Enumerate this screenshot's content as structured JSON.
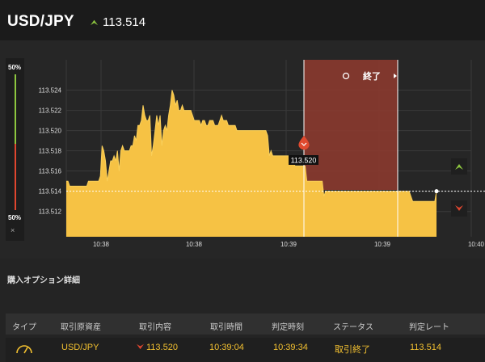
{
  "header": {
    "pair": "USD/JPY",
    "rate": "113.514",
    "colors": {
      "up": "#8dc63f",
      "down": "#e0462f"
    }
  },
  "chart_data": {
    "type": "area",
    "y_ticks": [
      "113.524",
      "113.522",
      "113.520",
      "113.518",
      "113.516",
      "113.514",
      "113.512"
    ],
    "x_ticks": [
      "10:38",
      "10:38",
      "10:39",
      "10:39",
      "10:40"
    ],
    "ylim": [
      113.5095,
      113.527
    ],
    "series": [
      {
        "values": [
          113.515,
          113.515,
          113.5145,
          113.5145,
          113.5145,
          113.5145,
          113.5145,
          113.5145,
          113.5145,
          113.5145,
          113.5145,
          113.5145,
          113.5145,
          113.515,
          113.515,
          113.515,
          113.515,
          113.515,
          113.515,
          113.515,
          113.5155,
          113.5185,
          113.518,
          113.517,
          113.515,
          113.516,
          113.517,
          113.517,
          113.5175,
          113.517,
          113.518,
          113.516,
          113.518,
          113.5185,
          113.518,
          113.518,
          113.518,
          113.518,
          113.5185,
          113.5185,
          113.5195,
          113.519,
          113.5205,
          113.5205,
          113.521,
          113.5225,
          113.5215,
          113.521,
          113.521,
          113.5215,
          113.5175,
          113.5185,
          113.52,
          113.5215,
          113.5205,
          113.5215,
          113.5185,
          113.52,
          113.5205,
          113.52,
          113.5215,
          113.5225,
          113.524,
          113.5235,
          113.5225,
          113.523,
          113.522,
          113.522,
          113.5225,
          113.522,
          113.522,
          113.522,
          113.522,
          113.522,
          113.5215,
          113.521,
          113.521,
          113.521,
          113.521,
          113.5205,
          113.521,
          113.521,
          113.5205,
          113.5205,
          113.521,
          113.521,
          113.521,
          113.5205,
          113.5205,
          113.5205,
          113.521,
          113.5215,
          113.521,
          113.521,
          113.521,
          113.5205,
          113.5205,
          113.5205,
          113.5205,
          113.5205,
          113.52,
          113.52,
          113.52,
          113.52,
          113.52,
          113.52,
          113.52,
          113.52,
          113.52,
          113.52,
          113.52,
          113.52,
          113.52,
          113.52,
          113.52,
          113.52,
          113.52,
          113.52,
          113.5195,
          113.5175,
          113.518,
          113.5175,
          113.5175,
          113.5175,
          113.5175,
          113.5175,
          113.5175,
          113.5175,
          113.5175,
          113.5175,
          113.5175,
          113.5175,
          113.5175,
          113.5175,
          113.5165,
          113.5165,
          113.5165,
          113.5165,
          113.5165,
          113.5165,
          113.5165,
          113.515,
          113.515,
          113.515,
          113.515,
          113.515,
          113.515,
          113.515,
          113.515,
          113.515,
          113.515,
          113.5135,
          113.514,
          113.514,
          113.514,
          113.514,
          113.514,
          113.514,
          113.514,
          113.514,
          113.514,
          113.514,
          113.514,
          113.514,
          113.514,
          113.514,
          113.514,
          113.514,
          113.514,
          113.514,
          113.514,
          113.514,
          113.514,
          113.514,
          113.514,
          113.514,
          113.514,
          113.514,
          113.514,
          113.514,
          113.514,
          113.514,
          113.514,
          113.514,
          113.514,
          113.514,
          113.514,
          113.514,
          113.514,
          113.514,
          113.514,
          113.514,
          113.514,
          113.514,
          113.514,
          113.514,
          113.514,
          113.514,
          113.514,
          113.514,
          113.514,
          113.514,
          113.5135,
          113.513,
          113.513,
          113.513,
          113.513,
          113.513,
          113.513,
          113.513,
          113.513,
          113.513,
          113.513,
          113.513,
          113.513,
          113.513,
          113.513,
          113.514
        ]
      }
    ],
    "entry_rate": "113.520",
    "current_rate": 113.514,
    "expired_label": "終了"
  },
  "sidebar": {
    "top_pct": "50%",
    "bottom_pct": "50%",
    "close": "×"
  },
  "section_title": "購入オプション詳細",
  "table": {
    "headers": [
      "タイプ",
      "取引原資産",
      "取引内容",
      "取引時間",
      "判定時刻",
      "ステータス",
      "判定レート"
    ],
    "row": {
      "asset": "USD/JPY",
      "content": "113.520",
      "trade_time": "10:39:04",
      "judge_time": "10:39:34",
      "status": "取引終了",
      "judge_rate": "113.514"
    }
  }
}
